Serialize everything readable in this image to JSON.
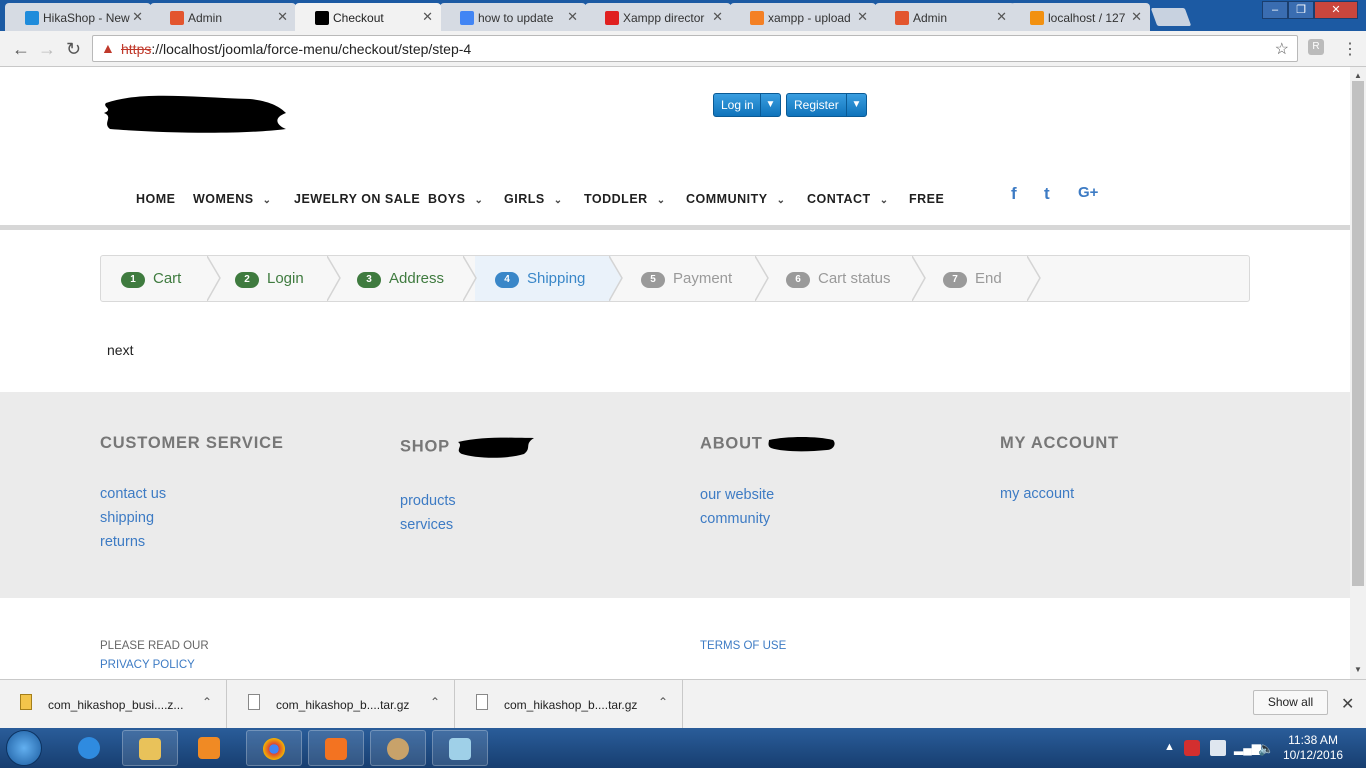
{
  "browser": {
    "tabs": [
      {
        "title": "HikaShop - New",
        "icon_color": "#1f8cdb"
      },
      {
        "title": "Admin",
        "icon_color": "#e3552e"
      },
      {
        "title": "Checkout",
        "icon_color": "#000000"
      },
      {
        "title": "how to update",
        "icon_color": "#4285f4"
      },
      {
        "title": "Xampp director",
        "icon_color": "#e02020"
      },
      {
        "title": "xampp - upload",
        "icon_color": "#f48024"
      },
      {
        "title": "Admin",
        "icon_color": "#e3552e"
      },
      {
        "title": "localhost / 127",
        "icon_color": "#f29111"
      }
    ],
    "url_scheme": "https",
    "url_rest": "://localhost/joomla/force-menu/checkout/step/step-4",
    "window_controls": [
      "–",
      "❐",
      "✕"
    ]
  },
  "header": {
    "login_label": "Log in",
    "register_label": "Register"
  },
  "nav": {
    "items": [
      {
        "label": "HOME",
        "dropdown": false
      },
      {
        "label": "WOMENS",
        "dropdown": true
      },
      {
        "label": "JEWELRY ON SALE",
        "dropdown": false
      },
      {
        "label": "BOYS",
        "dropdown": true
      },
      {
        "label": "GIRLS",
        "dropdown": true
      },
      {
        "label": "TODDLER",
        "dropdown": true
      },
      {
        "label": "COMMUNITY",
        "dropdown": true
      },
      {
        "label": "CONTACT",
        "dropdown": true
      },
      {
        "label": "FREE",
        "dropdown": false
      }
    ],
    "social": [
      "f",
      "t",
      "G+"
    ]
  },
  "checkout": {
    "steps": [
      {
        "num": "1",
        "label": "Cart",
        "state": "done"
      },
      {
        "num": "2",
        "label": "Login",
        "state": "done"
      },
      {
        "num": "3",
        "label": "Address",
        "state": "done"
      },
      {
        "num": "4",
        "label": "Shipping",
        "state": "current"
      },
      {
        "num": "5",
        "label": "Payment",
        "state": "todo"
      },
      {
        "num": "6",
        "label": "Cart status",
        "state": "todo"
      },
      {
        "num": "7",
        "label": "End",
        "state": "todo"
      }
    ],
    "next_text": "next"
  },
  "footer": {
    "columns": [
      {
        "heading": "CUSTOMER SERVICE",
        "links": [
          "contact us",
          "shipping",
          "returns"
        ]
      },
      {
        "heading": "SHOP",
        "links": [
          "products",
          "services"
        ]
      },
      {
        "heading": "ABOUT",
        "links": [
          "our website",
          "community"
        ]
      },
      {
        "heading": "MY ACCOUNT",
        "links": [
          "my account"
        ]
      }
    ],
    "please_read": "PLEASE READ OUR",
    "privacy_policy": "PRIVACY POLICY",
    "terms_of_use": "TERMS OF USE"
  },
  "downloads": {
    "items": [
      {
        "name": "com_hikashop_busi....z...",
        "type": "zip"
      },
      {
        "name": "com_hikashop_b....tar.gz",
        "type": "file"
      },
      {
        "name": "com_hikashop_b....tar.gz",
        "type": "file"
      }
    ],
    "show_all_label": "Show all"
  },
  "taskbar": {
    "time": "11:38 AM",
    "date": "10/12/2016"
  }
}
